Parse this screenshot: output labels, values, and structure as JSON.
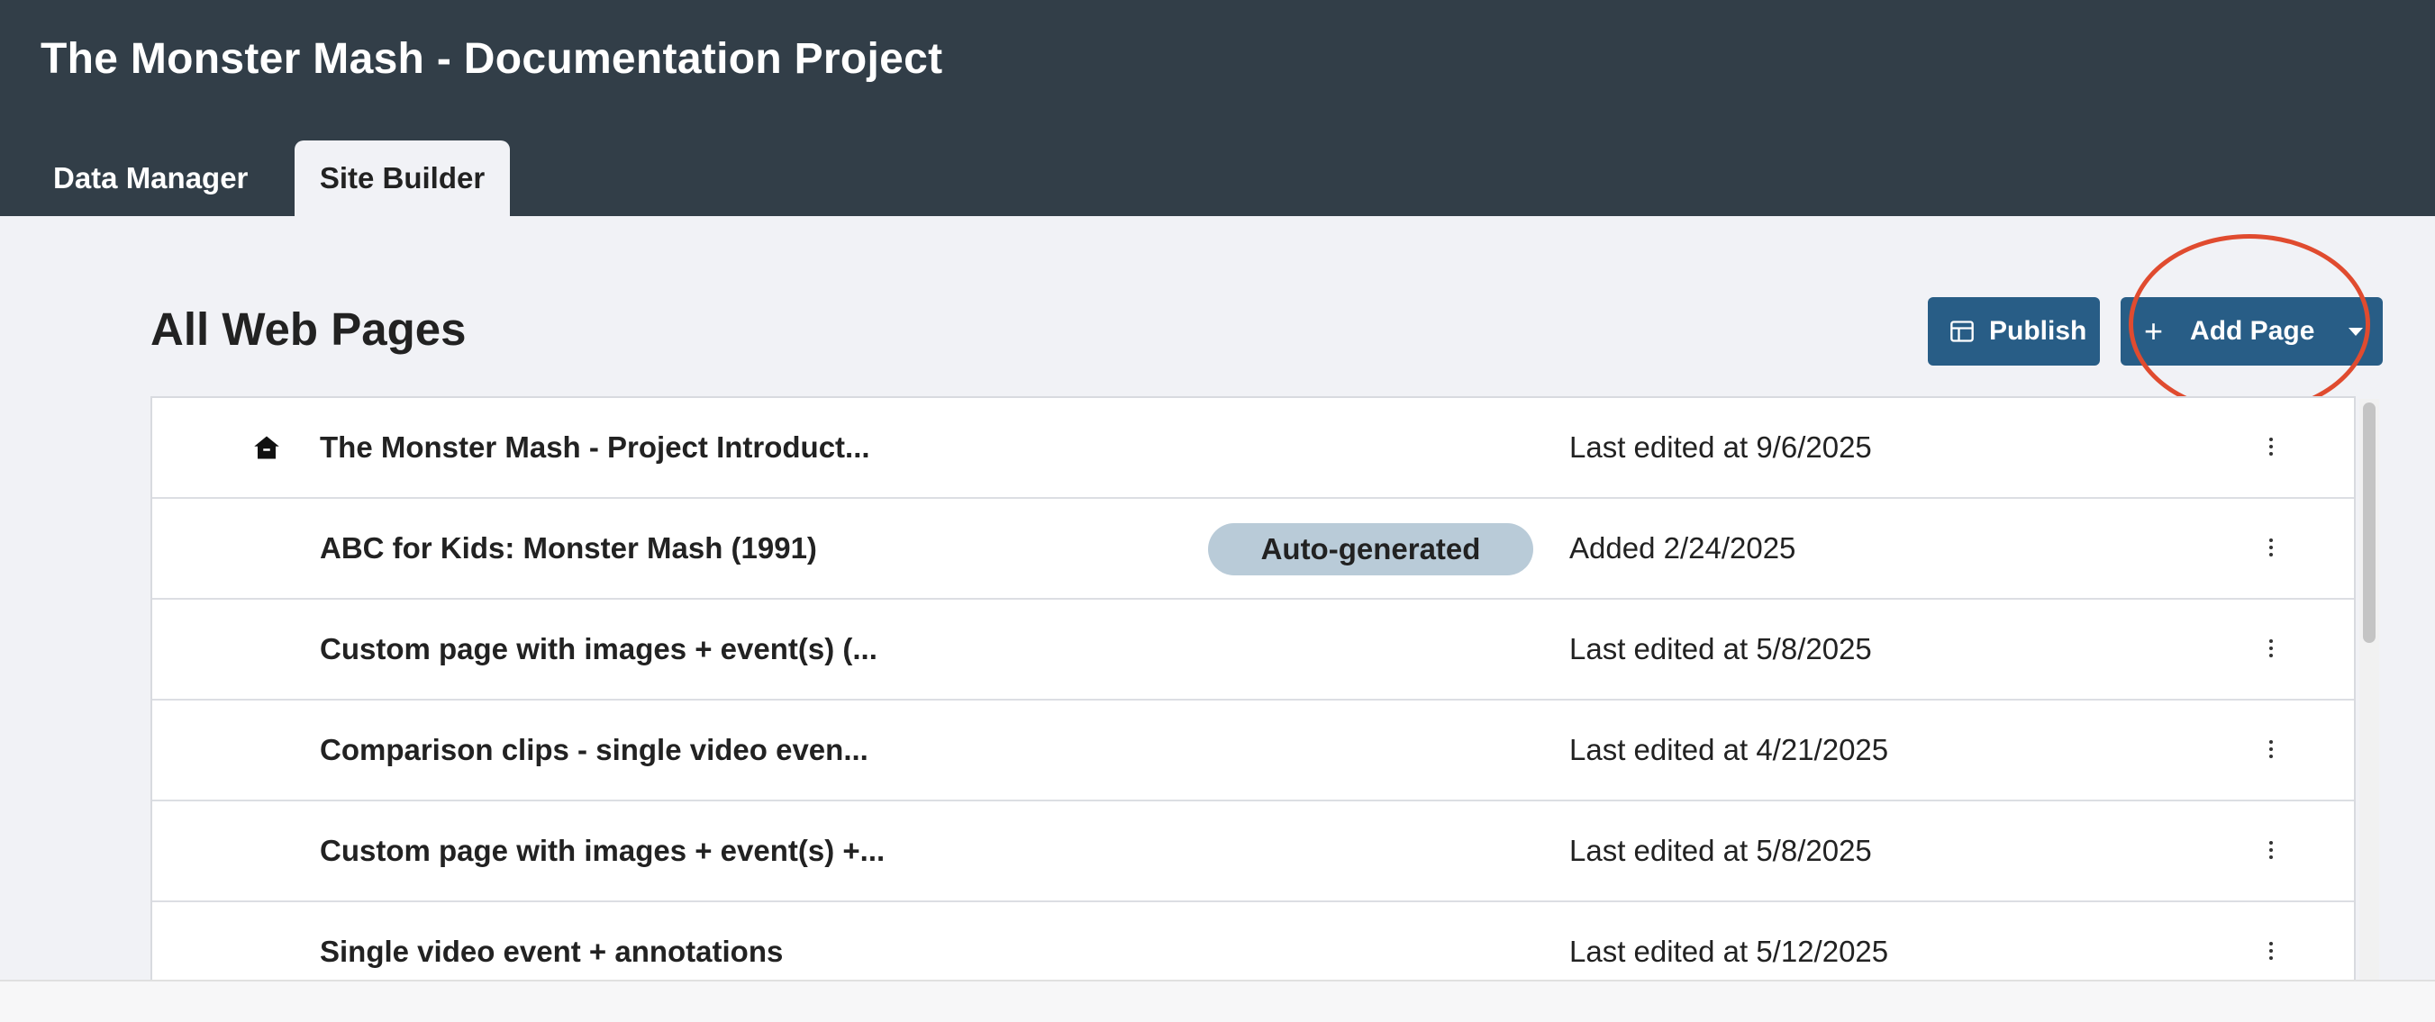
{
  "app": {
    "title": "The Monster Mash - Documentation Project"
  },
  "tabs": [
    {
      "label": "Data Manager",
      "active": false
    },
    {
      "label": "Site Builder",
      "active": true
    }
  ],
  "main": {
    "section_title": "All Web Pages",
    "publish_label": "Publish",
    "add_page_label": "Add Page",
    "rows": [
      {
        "title": "The Monster Mash - Project Introduct...",
        "date": "Last edited at 9/6/2025",
        "home": true,
        "badge": ""
      },
      {
        "title": "ABC for Kids: Monster Mash (1991)",
        "date": "Added 2/24/2025",
        "home": false,
        "badge": "Auto-generated"
      },
      {
        "title": "Custom page with images + event(s) (...",
        "date": "Last edited at 5/8/2025",
        "home": false,
        "badge": ""
      },
      {
        "title": "Comparison clips - single video even...",
        "date": "Last edited at 4/21/2025",
        "home": false,
        "badge": ""
      },
      {
        "title": "Custom page with images + event(s) +...",
        "date": "Last edited at 5/8/2025",
        "home": false,
        "badge": ""
      },
      {
        "title": "Single video event + annotations",
        "date": "Last edited at 5/12/2025",
        "home": false,
        "badge": ""
      }
    ]
  },
  "colors": {
    "header_bg": "#323e48",
    "button_bg": "#285d86",
    "badge_bg": "#b9cbd8",
    "highlight": "#e04b2f"
  }
}
